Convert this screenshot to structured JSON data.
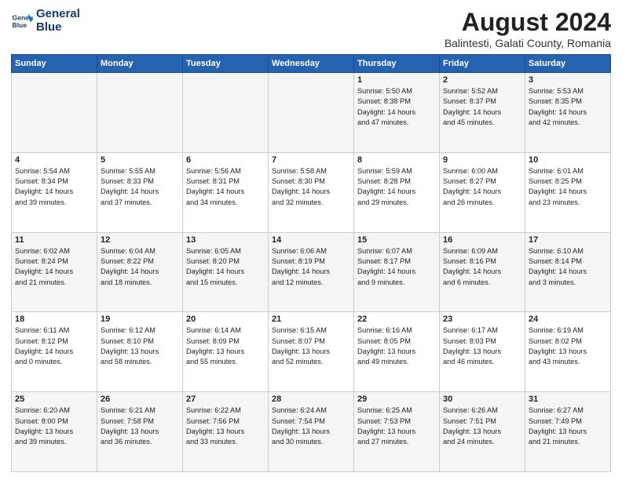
{
  "header": {
    "logo_line1": "General",
    "logo_line2": "Blue",
    "title": "August 2024",
    "subtitle": "Balintesti, Galati County, Romania"
  },
  "days_of_week": [
    "Sunday",
    "Monday",
    "Tuesday",
    "Wednesday",
    "Thursday",
    "Friday",
    "Saturday"
  ],
  "weeks": [
    [
      {
        "day": "",
        "info": ""
      },
      {
        "day": "",
        "info": ""
      },
      {
        "day": "",
        "info": ""
      },
      {
        "day": "",
        "info": ""
      },
      {
        "day": "1",
        "info": "Sunrise: 5:50 AM\nSunset: 8:38 PM\nDaylight: 14 hours\nand 47 minutes."
      },
      {
        "day": "2",
        "info": "Sunrise: 5:52 AM\nSunset: 8:37 PM\nDaylight: 14 hours\nand 45 minutes."
      },
      {
        "day": "3",
        "info": "Sunrise: 5:53 AM\nSunset: 8:35 PM\nDaylight: 14 hours\nand 42 minutes."
      }
    ],
    [
      {
        "day": "4",
        "info": "Sunrise: 5:54 AM\nSunset: 8:34 PM\nDaylight: 14 hours\nand 39 minutes."
      },
      {
        "day": "5",
        "info": "Sunrise: 5:55 AM\nSunset: 8:33 PM\nDaylight: 14 hours\nand 37 minutes."
      },
      {
        "day": "6",
        "info": "Sunrise: 5:56 AM\nSunset: 8:31 PM\nDaylight: 14 hours\nand 34 minutes."
      },
      {
        "day": "7",
        "info": "Sunrise: 5:58 AM\nSunset: 8:30 PM\nDaylight: 14 hours\nand 32 minutes."
      },
      {
        "day": "8",
        "info": "Sunrise: 5:59 AM\nSunset: 8:28 PM\nDaylight: 14 hours\nand 29 minutes."
      },
      {
        "day": "9",
        "info": "Sunrise: 6:00 AM\nSunset: 8:27 PM\nDaylight: 14 hours\nand 26 minutes."
      },
      {
        "day": "10",
        "info": "Sunrise: 6:01 AM\nSunset: 8:25 PM\nDaylight: 14 hours\nand 23 minutes."
      }
    ],
    [
      {
        "day": "11",
        "info": "Sunrise: 6:02 AM\nSunset: 8:24 PM\nDaylight: 14 hours\nand 21 minutes."
      },
      {
        "day": "12",
        "info": "Sunrise: 6:04 AM\nSunset: 8:22 PM\nDaylight: 14 hours\nand 18 minutes."
      },
      {
        "day": "13",
        "info": "Sunrise: 6:05 AM\nSunset: 8:20 PM\nDaylight: 14 hours\nand 15 minutes."
      },
      {
        "day": "14",
        "info": "Sunrise: 6:06 AM\nSunset: 8:19 PM\nDaylight: 14 hours\nand 12 minutes."
      },
      {
        "day": "15",
        "info": "Sunrise: 6:07 AM\nSunset: 8:17 PM\nDaylight: 14 hours\nand 9 minutes."
      },
      {
        "day": "16",
        "info": "Sunrise: 6:09 AM\nSunset: 8:16 PM\nDaylight: 14 hours\nand 6 minutes."
      },
      {
        "day": "17",
        "info": "Sunrise: 6:10 AM\nSunset: 8:14 PM\nDaylight: 14 hours\nand 3 minutes."
      }
    ],
    [
      {
        "day": "18",
        "info": "Sunrise: 6:11 AM\nSunset: 8:12 PM\nDaylight: 14 hours\nand 0 minutes."
      },
      {
        "day": "19",
        "info": "Sunrise: 6:12 AM\nSunset: 8:10 PM\nDaylight: 13 hours\nand 58 minutes."
      },
      {
        "day": "20",
        "info": "Sunrise: 6:14 AM\nSunset: 8:09 PM\nDaylight: 13 hours\nand 55 minutes."
      },
      {
        "day": "21",
        "info": "Sunrise: 6:15 AM\nSunset: 8:07 PM\nDaylight: 13 hours\nand 52 minutes."
      },
      {
        "day": "22",
        "info": "Sunrise: 6:16 AM\nSunset: 8:05 PM\nDaylight: 13 hours\nand 49 minutes."
      },
      {
        "day": "23",
        "info": "Sunrise: 6:17 AM\nSunset: 8:03 PM\nDaylight: 13 hours\nand 46 minutes."
      },
      {
        "day": "24",
        "info": "Sunrise: 6:19 AM\nSunset: 8:02 PM\nDaylight: 13 hours\nand 43 minutes."
      }
    ],
    [
      {
        "day": "25",
        "info": "Sunrise: 6:20 AM\nSunset: 8:00 PM\nDaylight: 13 hours\nand 39 minutes."
      },
      {
        "day": "26",
        "info": "Sunrise: 6:21 AM\nSunset: 7:58 PM\nDaylight: 13 hours\nand 36 minutes."
      },
      {
        "day": "27",
        "info": "Sunrise: 6:22 AM\nSunset: 7:56 PM\nDaylight: 13 hours\nand 33 minutes."
      },
      {
        "day": "28",
        "info": "Sunrise: 6:24 AM\nSunset: 7:54 PM\nDaylight: 13 hours\nand 30 minutes."
      },
      {
        "day": "29",
        "info": "Sunrise: 6:25 AM\nSunset: 7:53 PM\nDaylight: 13 hours\nand 27 minutes."
      },
      {
        "day": "30",
        "info": "Sunrise: 6:26 AM\nSunset: 7:51 PM\nDaylight: 13 hours\nand 24 minutes."
      },
      {
        "day": "31",
        "info": "Sunrise: 6:27 AM\nSunset: 7:49 PM\nDaylight: 13 hours\nand 21 minutes."
      }
    ]
  ]
}
